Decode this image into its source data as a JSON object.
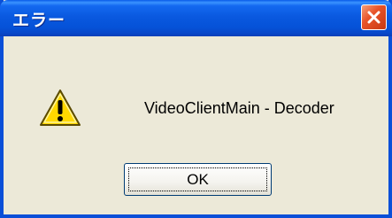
{
  "window": {
    "title": "エラー"
  },
  "dialog": {
    "message": "VideoClientMain - Decoder",
    "icon": "warning-icon",
    "ok_label": "OK"
  },
  "colors": {
    "title_bar": "#0a59e0",
    "close_button": "#e8542a",
    "dialog_background": "#ece9d8",
    "warning_yellow": "#ffd800"
  }
}
